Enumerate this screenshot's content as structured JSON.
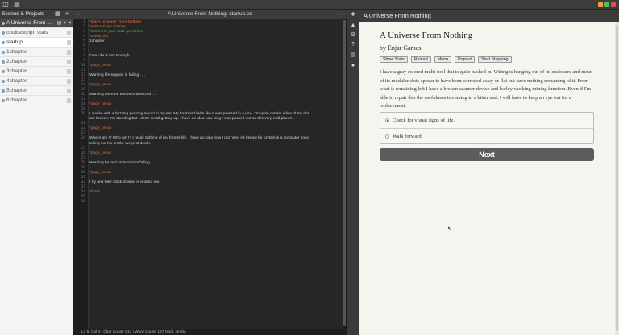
{
  "sidebar": {
    "header": "Scenes & Projects",
    "project": "A Universe From ...",
    "scenes": [
      "choicescript_stats",
      "startup",
      "1chapter",
      "2chapter",
      "3chapter",
      "4chapter",
      "5chapter",
      "6chapter"
    ]
  },
  "editor": {
    "title": "A Universe From Nothing: startup.txt",
    "lines": [
      {
        "n": "1",
        "text": "*title A Universe From Nothing",
        "type": "cmd"
      },
      {
        "n": "2",
        "text": "*author Enjar Games",
        "type": "cmd"
      },
      {
        "n": "3",
        "text": "*comment your code goes here",
        "type": "com"
      },
      {
        "n": "4",
        "text": "*scene_list",
        "type": "cmd"
      },
      {
        "n": "5",
        "text": "      1chapter",
        "type": "txt"
      },
      {
        "n": "6",
        "text": "",
        "type": "txt"
      },
      {
        "n": "7",
        "text": "",
        "type": "txt"
      },
      {
        "n": "8",
        "text": "One Life is Not Enough",
        "type": "txt"
      },
      {
        "n": "9",
        "text": "",
        "type": "txt"
      },
      {
        "n": "10",
        "text": "*page_break",
        "type": "cmd"
      },
      {
        "n": "11",
        "text": "",
        "type": "txt"
      },
      {
        "n": "12",
        "text": "Warning life support is failing . . .",
        "type": "txt"
      },
      {
        "n": "13",
        "text": "",
        "type": "txt"
      },
      {
        "n": "14",
        "text": "*page_break",
        "type": "cmd"
      },
      {
        "n": "15",
        "text": "",
        "type": "txt"
      },
      {
        "n": "16",
        "text": "Warning extreme tempters detected . . .",
        "type": "txt"
      },
      {
        "n": "17",
        "text": "",
        "type": "txt"
      },
      {
        "n": "18",
        "text": "*page_break",
        "type": "cmd"
      },
      {
        "n": "19",
        "text": "",
        "type": "txt"
      },
      {
        "n": "20",
        "text": "I awake with a buzzing piercing sound in my ear. My forehead feels like it was pressed in a vice. I'm quite certain a few of my ribs",
        "type": "txt"
      },
      {
        "n": "",
        "text": "are broken. I'm standing but I don't' recall getting up. I have no idea how long I was passed out on this very cold planet.",
        "type": "txt"
      },
      {
        "n": "21",
        "text": "",
        "type": "txt"
      },
      {
        "n": "22",
        "text": "*page_break",
        "type": "cmd"
      },
      {
        "n": "23",
        "text": "",
        "type": "txt"
      },
      {
        "n": "24",
        "text": "Where am I? Who am I? I recall nothing of my former life. I have no idea how I got here. All I know for certain is a computer voice",
        "type": "txt"
      },
      {
        "n": "",
        "text": "telling me I'm on the verge of death.",
        "type": "txt"
      },
      {
        "n": "25",
        "text": "",
        "type": "txt"
      },
      {
        "n": "26",
        "text": "*page_break",
        "type": "cmd"
      },
      {
        "n": "27",
        "text": "",
        "type": "txt"
      },
      {
        "n": "28",
        "text": "Warning hazard protection is failing . . .",
        "type": "txt"
      },
      {
        "n": "29",
        "text": "",
        "type": "txt"
      },
      {
        "n": "30",
        "text": "*page_break",
        "type": "cmd"
      },
      {
        "n": "31",
        "text": "",
        "type": "txt"
      },
      {
        "n": "32",
        "text": "I try and take stock of what is around me.",
        "type": "txt"
      },
      {
        "n": "33",
        "text": "",
        "type": "txt"
      },
      {
        "n": "34",
        "text": "*finish",
        "type": "blue"
      },
      {
        "n": "35",
        "text": "",
        "type": "txt"
      },
      {
        "n": "36",
        "text": "",
        "type": "txt"
      }
    ],
    "status": "Ln 6, Col 4 | Char Count: 817 | Word Count: 127 (excl. cmds)"
  },
  "game": {
    "header": "A Universe From Nothing",
    "title": "A Universe From Nothing",
    "author": "by Enjar Games",
    "buttons": [
      "Show Stats",
      "Restart",
      "Menu",
      "Popout",
      "Start Stepping"
    ],
    "text": "I have a gray colored multi-tool that is quite bashed in. Wiring is hanging out of its enclosure and most of its modular slots appear to have been corroded away or flat out have nothing remaining of it. From what is remaining left I have a broken scanner device and barley working mining function. Even if I'm able to repair this the usefulness is coming to a bitter end. I will have to keep an eye out for a replacement.",
    "choices": [
      "Check for visual signs of life.",
      "Walk forward"
    ],
    "next_label": "Next"
  },
  "colors": {
    "command": "#e06c4a",
    "comment": "#5fb35f",
    "finish": "#4f9be0",
    "next_button": "#5b5b5b"
  }
}
